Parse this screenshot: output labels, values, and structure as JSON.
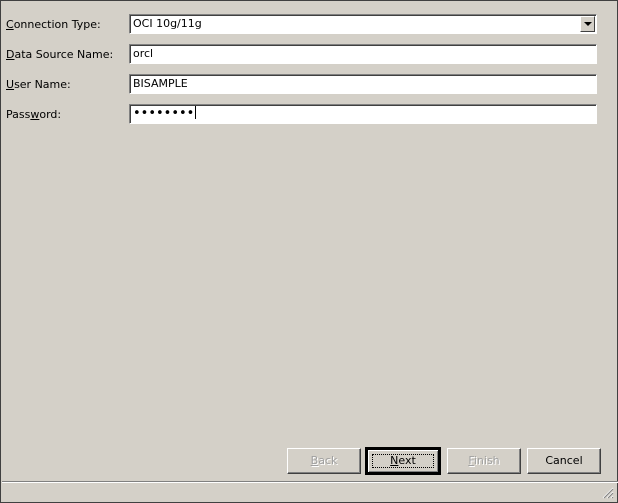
{
  "form": {
    "connection_type": {
      "label_prefix": "",
      "label_mnemonic": "C",
      "label_rest": "onnection Type:",
      "value": "OCI 10g/11g"
    },
    "data_source_name": {
      "label_mnemonic": "D",
      "label_rest": "ata Source Name:",
      "value": "orcl"
    },
    "user_name": {
      "label_mnemonic": "U",
      "label_rest": "ser Name:",
      "value": "BISAMPLE"
    },
    "password": {
      "label_prefix": "Pass",
      "label_mnemonic": "w",
      "label_rest": "ord:",
      "value": "••••••••"
    }
  },
  "buttons": {
    "back": {
      "mnemonic": "B",
      "rest": "ack",
      "enabled": false
    },
    "next": {
      "mnemonic": "N",
      "rest": "ext",
      "enabled": true
    },
    "finish": {
      "mnemonic": "F",
      "rest": "inish",
      "enabled": false
    },
    "cancel": {
      "label": "Cancel",
      "enabled": true
    }
  },
  "icons": {
    "dropdown": "chevron-down-icon",
    "resize": "resize-grip-icon"
  }
}
